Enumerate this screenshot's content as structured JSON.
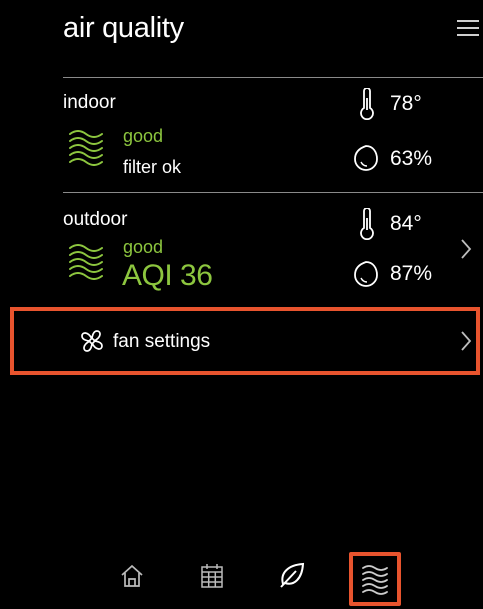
{
  "header": {
    "title": "air quality",
    "menu_icon": "hamburger-menu-icon"
  },
  "indoor": {
    "label": "indoor",
    "status": "good",
    "detail": "filter ok",
    "temperature": "78°",
    "humidity": "63%",
    "status_icon": "air-waves-icon",
    "temp_icon": "thermometer-icon",
    "humidity_icon": "water-drop-icon"
  },
  "outdoor": {
    "label": "outdoor",
    "status": "good",
    "aqi": "AQI 36",
    "temperature": "84°",
    "humidity": "87%",
    "status_icon": "air-waves-icon",
    "temp_icon": "thermometer-icon",
    "humidity_icon": "water-drop-icon"
  },
  "fan": {
    "label": "fan settings",
    "icon": "fan-icon"
  },
  "bottom_nav": {
    "items": [
      {
        "name": "home",
        "icon": "home-icon"
      },
      {
        "name": "schedule",
        "icon": "calendar-icon"
      },
      {
        "name": "eco",
        "icon": "leaf-icon"
      },
      {
        "name": "air-quality",
        "icon": "air-waves-icon",
        "active": true
      }
    ]
  },
  "colors": {
    "background": "#000000",
    "accent_green": "#8dc63f",
    "highlight": "#e8542e",
    "divider": "#8a8a8a"
  }
}
